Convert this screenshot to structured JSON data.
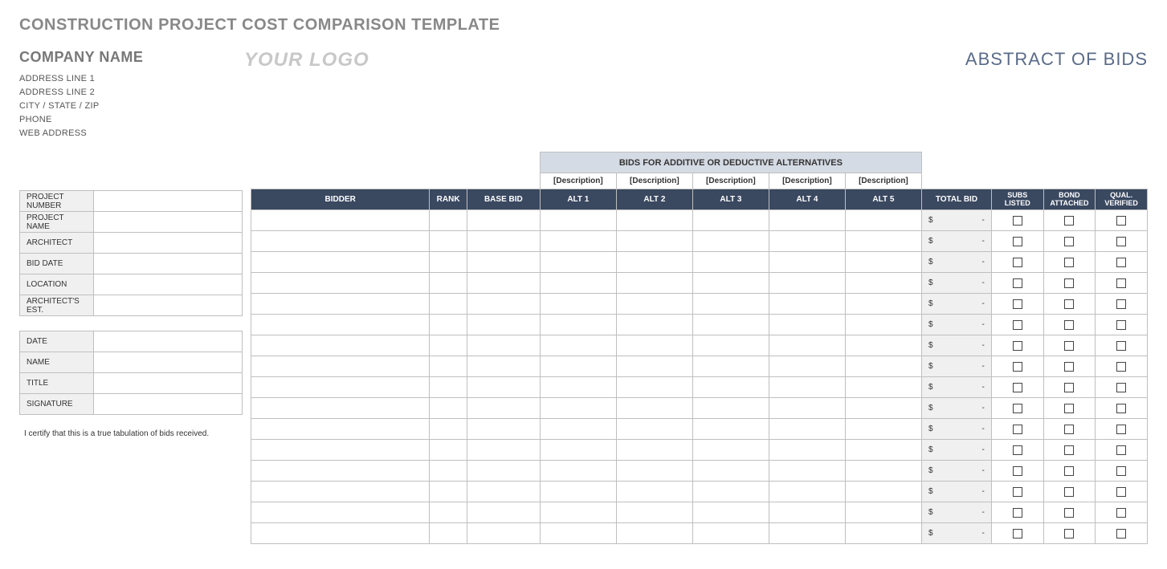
{
  "title": "CONSTRUCTION PROJECT COST COMPARISON TEMPLATE",
  "company": {
    "name": "COMPANY NAME",
    "address1": "ADDRESS LINE 1",
    "address2": "ADDRESS LINE 2",
    "citystatezip": "CITY / STATE / ZIP",
    "phone": "PHONE",
    "web": "WEB ADDRESS"
  },
  "logo_text": "YOUR LOGO",
  "abstract_title": "ABSTRACT OF BIDS",
  "project_info": {
    "labels": {
      "project_number": "PROJECT NUMBER",
      "project_name": "PROJECT NAME",
      "architect": "ARCHITECT",
      "bid_date": "BID DATE",
      "location": "LOCATION",
      "arch_est": "ARCHITECT'S EST."
    },
    "values": {
      "project_number": "",
      "project_name": "",
      "architect": "",
      "bid_date": "",
      "location": "",
      "arch_est": ""
    }
  },
  "sign_info": {
    "labels": {
      "date": "DATE",
      "name": "NAME",
      "title": "TITLE",
      "signature": "SIGNATURE"
    },
    "values": {
      "date": "",
      "name": "",
      "title": "",
      "signature": ""
    }
  },
  "certify_text": "I certify that this is a true tabulation of bids received.",
  "bids_header": "BIDS FOR ADDITIVE OR DEDUCTIVE ALTERNATIVES",
  "alt_descriptions": [
    "[Description]",
    "[Description]",
    "[Description]",
    "[Description]",
    "[Description]"
  ],
  "columns": {
    "bidder": "BIDDER",
    "rank": "RANK",
    "base_bid": "BASE BID",
    "alt1": "ALT 1",
    "alt2": "ALT 2",
    "alt3": "ALT 3",
    "alt4": "ALT 4",
    "alt5": "ALT 5",
    "total_bid": "TOTAL BID",
    "subs_listed": "SUBS LISTED",
    "bond_attached": "BOND ATTACHED",
    "qual_verified": "QUAL. VERIFIED"
  },
  "total_placeholder": {
    "currency": "$",
    "value": "-"
  },
  "row_count": 16
}
